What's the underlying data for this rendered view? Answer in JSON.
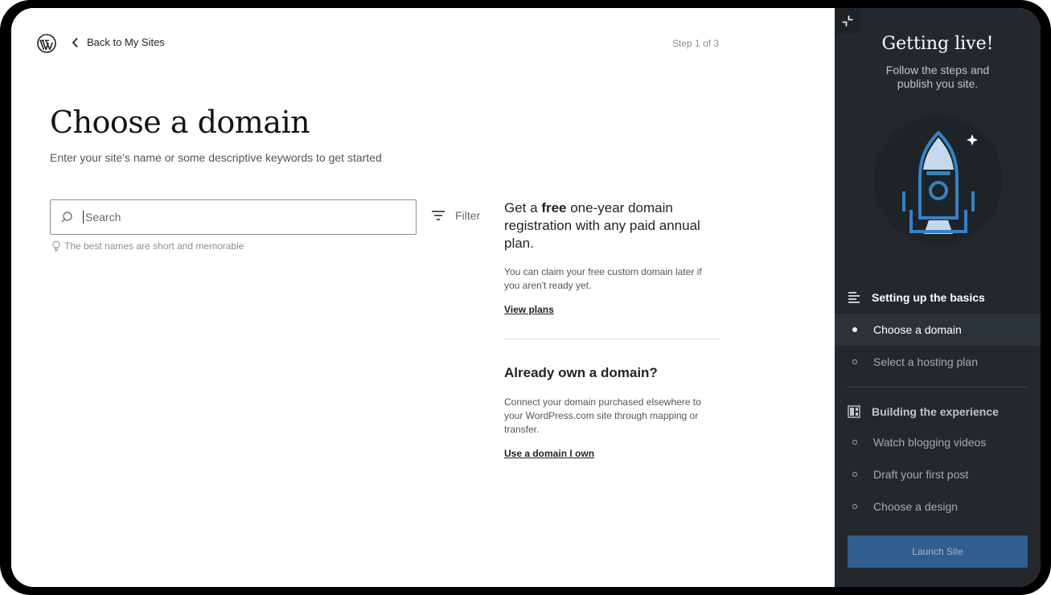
{
  "header": {
    "back_label": "Back to My Sites",
    "step_label": "Step 1 of 3"
  },
  "main": {
    "title": "Choose a domain",
    "subtitle": "Enter your site's name or some descriptive keywords to get started",
    "search": {
      "placeholder": "Search",
      "value": ""
    },
    "hint": "The best names are short and memorable",
    "filter_label": "Filter"
  },
  "promo": {
    "heading_prefix": "Get a ",
    "heading_bold": "free",
    "heading_suffix": " one-year domain registration with any paid annual plan.",
    "text": "You can claim your free custom domain later if you aren't ready yet.",
    "link": "View plans"
  },
  "own_domain": {
    "heading": "Already own a domain?",
    "text": "Connect your domain purchased elsewhere to your WordPress.com site through mapping or transfer.",
    "link": "Use a domain I own"
  },
  "sidebar": {
    "title": "Getting live!",
    "subtitle": "Follow the steps and publish you site.",
    "sections": [
      {
        "label": "Setting up the basics",
        "tasks": [
          {
            "label": "Choose a domain",
            "active": true
          },
          {
            "label": "Select a hosting plan",
            "active": false
          }
        ]
      },
      {
        "label": "Building the experience",
        "tasks": [
          {
            "label": "Watch blogging videos",
            "active": false
          },
          {
            "label": "Draft your first post",
            "active": false
          },
          {
            "label": "Choose a design",
            "active": false
          }
        ]
      }
    ],
    "launch_label": "Launch Site"
  },
  "colors": {
    "sidebar_bg": "#23282d",
    "accent_blue": "#2f5f8f",
    "rocket_blue": "#3582c4"
  },
  "icons": [
    "wordpress-logo-icon",
    "chevron-left-icon",
    "search-icon",
    "lightbulb-icon",
    "filter-icon",
    "collapse-icon",
    "list-icon",
    "grid-icon",
    "rocket-icon"
  ]
}
